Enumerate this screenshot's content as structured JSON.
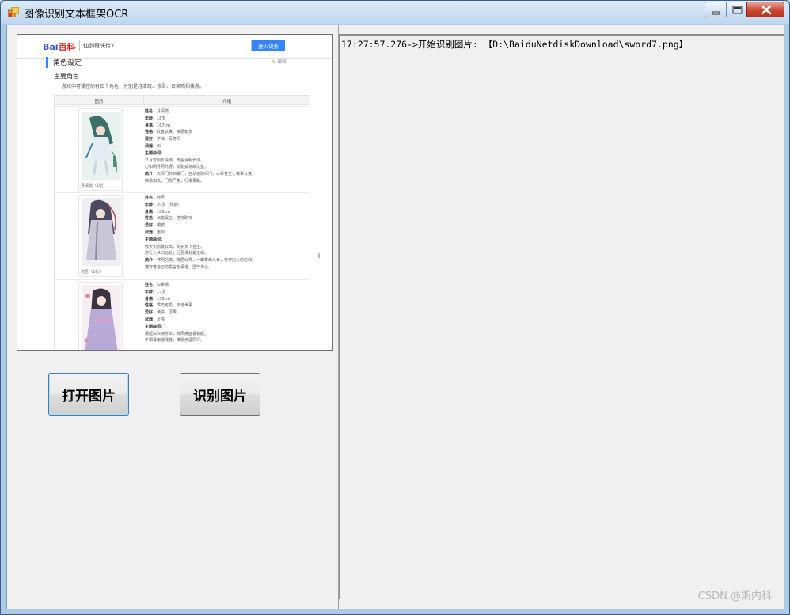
{
  "window": {
    "title": "图像识别文本框架OCR",
    "controls": {
      "minimize": "minimize-icon",
      "maximize": "maximize-icon",
      "close": "close-icon"
    }
  },
  "buttons": {
    "open_label": "打开图片",
    "recognize_label": "识别图片"
  },
  "log": {
    "lines": [
      "17:27:57.276->开始识别图片: 【D:\\BaiduNetdiskDownload\\sword7.png】"
    ]
  },
  "preview": {
    "logo_left": "Bai",
    "logo_right": "百科",
    "search_value": "仙剑奇侠传7",
    "search_button": "进入词条",
    "section_title": "角色设定",
    "tools": "✎ 编辑",
    "subtitle": "主要角色",
    "intro": "游戏中可操控的有四个角色，分别是月清疏、修吾、白茉晴和桑游。",
    "table_headers": [
      "图册",
      "介绍"
    ],
    "characters": [
      {
        "caption": "月清疏（1张）",
        "lines": [
          [
            "姓名：",
            "月清疏"
          ],
          [
            "年龄：",
            "18岁"
          ],
          [
            "身高：",
            "167cm"
          ],
          [
            "性格：",
            "耿直认真、嫉恶如仇"
          ],
          [
            "爱好：",
            "学法、写符咒"
          ],
          [
            "武器：",
            "剑"
          ],
          [
            "主题曲词：",
            ""
          ],
          [
            "",
            "江月曾照影清疏，再看月明长河。"
          ],
          [
            "",
            "心如明月照九野，剑影孤寒欲沉星。"
          ],
          [
            "简介：",
            "天师门的四掌门，自幼追随师门，心系苍生，做事认真。"
          ],
          [
            "",
            "嫉恶如仇，门规严格，行事果断。"
          ]
        ]
      },
      {
        "caption": "修吾（1张）",
        "lines": [
          [
            "姓名：",
            "修吾"
          ],
          [
            "年龄：",
            "20岁（外貌）"
          ],
          [
            "身高：",
            "186cm"
          ],
          [
            "性格：",
            "沉稳寡言、恪守职守"
          ],
          [
            "爱好：",
            "喂鹤"
          ],
          [
            "武器：",
            "重剑"
          ],
          [
            "主题曲词：",
            ""
          ],
          [
            "",
            "修天引鹤破云出，剑护天下苍生。"
          ],
          [
            "",
            "修行入世归远处，行至深处是尘缘。"
          ],
          [
            "简介：",
            "神明之裔，身居仙界，一朝奉命入世，恪守内心的信仰。"
          ],
          [
            "",
            "遵守着自己的誓言与承诺，坚守本心。"
          ]
        ]
      },
      {
        "caption": "白茉晴（1张）",
        "lines": [
          [
            "姓名：",
            "白茉晴"
          ],
          [
            "年龄：",
            "17岁"
          ],
          [
            "身高：",
            "158cm"
          ],
          [
            "性格：",
            "乖巧可爱、不谙世事"
          ],
          [
            "爱好：",
            "读书、逗弄"
          ],
          [
            "武器：",
            "灵书"
          ],
          [
            "主题曲词：",
            ""
          ],
          [
            "",
            "晨起白衣映芳草，林风拂面香初起。"
          ],
          [
            "",
            "不惧暮雨侵残枝，惟愿天涯同行。"
          ]
        ]
      }
    ]
  },
  "watermark": "CSDN @斯内科"
}
